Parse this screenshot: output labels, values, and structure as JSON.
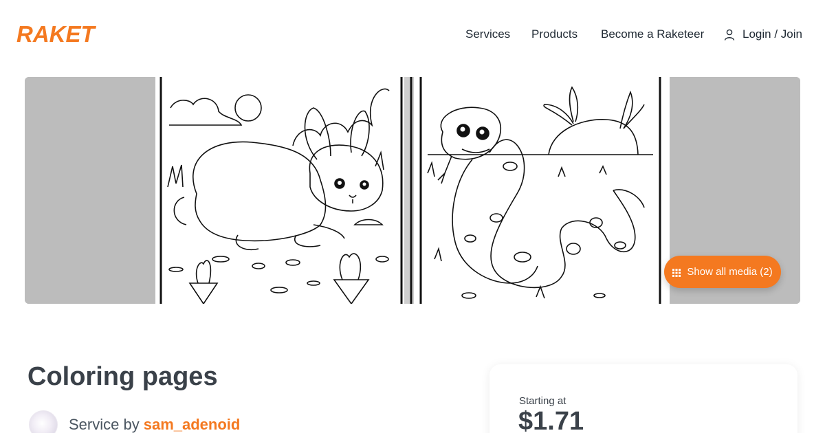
{
  "brand": {
    "name": "RAKET",
    "color": "#f47920"
  },
  "nav": {
    "services": "Services",
    "products": "Products",
    "become": "Become a Raketeer",
    "login": "Login / Join"
  },
  "gallery": {
    "show_all_label": "Show all media (2)",
    "images": [
      {
        "subject": "rabbit coloring page"
      },
      {
        "subject": "snake coloring page"
      }
    ]
  },
  "listing": {
    "title": "Coloring pages",
    "service_by": "Service by",
    "username": "sam_adenoid"
  },
  "pricing": {
    "starting_label": "Starting at",
    "price": "$1.71"
  }
}
